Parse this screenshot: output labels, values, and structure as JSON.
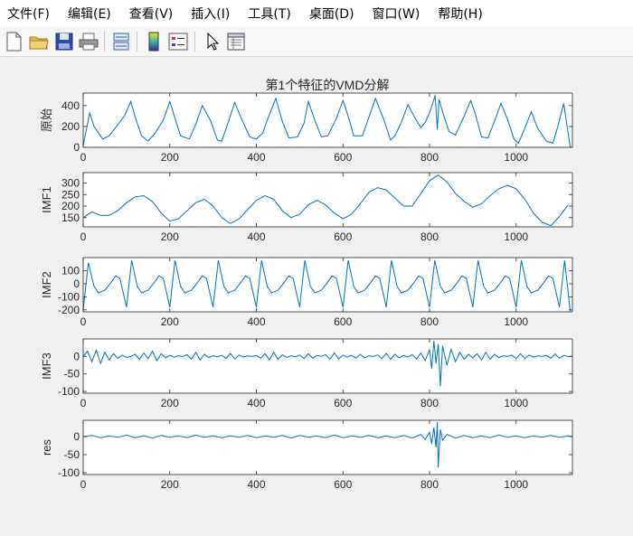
{
  "menubar": {
    "items": [
      "文件(F)",
      "编辑(E)",
      "查看(V)",
      "插入(I)",
      "工具(T)",
      "桌面(D)",
      "窗口(W)",
      "帮助(H)"
    ]
  },
  "toolbar": {
    "icons": [
      "new-file-icon",
      "open-folder-icon",
      "save-icon",
      "print-icon",
      "link-plot-icon",
      "colorbar-icon",
      "legend-icon",
      "pointer-icon",
      "property-inspector-icon"
    ]
  },
  "colors": {
    "line": "#0072BD",
    "axes_bg": "#ffffff",
    "figure_bg": "#f0f0f0"
  },
  "chart_data": {
    "type": "line",
    "title": "第1个特征的VMD分解",
    "xlim": [
      0,
      1130
    ],
    "x_ticks": [
      0,
      200,
      400,
      600,
      800,
      1000
    ],
    "subplots": [
      {
        "ylabel": "原始",
        "ylim": [
          0,
          520
        ],
        "y_ticks": [
          0,
          200,
          400
        ],
        "series": [
          {
            "x": [
              0,
              15,
              25,
              45,
              60,
              75,
              95,
              110,
              120,
              135,
              150,
              165,
              185,
              200,
              215,
              225,
              245,
              260,
              275,
              295,
              310,
              320,
              335,
              350,
              365,
              385,
              400,
              415,
              425,
              445,
              460,
              475,
              495,
              510,
              520,
              535,
              550,
              565,
              585,
              600,
              615,
              625,
              645,
              660,
              675,
              695,
              710,
              720,
              735,
              750,
              765,
              780,
              790,
              800,
              808,
              813,
              818,
              822,
              830,
              845,
              860,
              880,
              895,
              905,
              920,
              935,
              950,
              965,
              980,
              995,
              1005,
              1020,
              1035,
              1050,
              1070,
              1085,
              1095,
              1110,
              1125
            ],
            "y": [
              20,
              330,
              200,
              80,
              110,
              190,
              300,
              440,
              290,
              110,
              60,
              130,
              260,
              440,
              240,
              110,
              80,
              220,
              400,
              250,
              70,
              60,
              240,
              430,
              280,
              100,
              80,
              140,
              260,
              470,
              250,
              90,
              100,
              230,
              440,
              260,
              100,
              110,
              280,
              450,
              260,
              110,
              110,
              290,
              470,
              260,
              70,
              110,
              240,
              410,
              290,
              190,
              240,
              330,
              430,
              500,
              170,
              460,
              340,
              150,
              120,
              300,
              450,
              330,
              100,
              90,
              250,
              420,
              270,
              80,
              40,
              180,
              340,
              180,
              60,
              40,
              180,
              420,
              0
            ]
          }
        ]
      },
      {
        "ylabel": "IMF1",
        "ylim": [
          110,
          345
        ],
        "y_ticks": [
          150,
          200,
          250,
          300
        ],
        "series": [
          {
            "x": [
              0,
              20,
              40,
              60,
              80,
              100,
              120,
              140,
              160,
              180,
              200,
              220,
              240,
              260,
              280,
              300,
              320,
              340,
              360,
              380,
              400,
              420,
              440,
              460,
              480,
              500,
              520,
              540,
              560,
              580,
              600,
              620,
              640,
              660,
              680,
              700,
              720,
              740,
              760,
              780,
              800,
              820,
              840,
              860,
              880,
              900,
              920,
              940,
              960,
              980,
              1000,
              1020,
              1040,
              1060,
              1080,
              1100,
              1120
            ],
            "y": [
              150,
              175,
              160,
              160,
              180,
              215,
              240,
              245,
              220,
              170,
              135,
              145,
              180,
              215,
              230,
              200,
              150,
              125,
              145,
              185,
              225,
              245,
              230,
              180,
              150,
              165,
              205,
              225,
              205,
              170,
              145,
              165,
              210,
              260,
              280,
              270,
              235,
              200,
              200,
              255,
              310,
              335,
              305,
              255,
              220,
              195,
              210,
              245,
              275,
              290,
              275,
              230,
              170,
              130,
              115,
              155,
              205
            ]
          }
        ]
      },
      {
        "ylabel": "IMF2",
        "ylim": [
          -215,
          200
        ],
        "y_ticks": [
          -200,
          -100,
          0,
          100
        ],
        "series": [
          {
            "x": [
              0,
              12,
              25,
              35,
              50,
              62,
              75,
              85,
              100,
              112,
              125,
              135,
              150,
              162,
              175,
              185,
              200,
              212,
              225,
              235,
              250,
              262,
              275,
              285,
              300,
              312,
              325,
              335,
              350,
              362,
              375,
              385,
              400,
              412,
              425,
              435,
              450,
              462,
              475,
              485,
              500,
              512,
              525,
              535,
              550,
              562,
              575,
              585,
              600,
              612,
              625,
              635,
              650,
              662,
              675,
              685,
              700,
              712,
              725,
              735,
              750,
              762,
              775,
              785,
              800,
              812,
              825,
              835,
              850,
              862,
              875,
              885,
              900,
              912,
              925,
              935,
              950,
              962,
              975,
              985,
              1000,
              1012,
              1025,
              1035,
              1050,
              1062,
              1075,
              1085,
              1100,
              1112,
              1125
            ],
            "y": [
              -200,
              160,
              -20,
              -70,
              -50,
              0,
              60,
              40,
              -180,
              180,
              -20,
              -70,
              -50,
              0,
              60,
              40,
              -180,
              180,
              -20,
              -70,
              -50,
              0,
              60,
              40,
              -180,
              180,
              -20,
              -70,
              -50,
              0,
              60,
              40,
              -180,
              180,
              -20,
              -70,
              -50,
              0,
              60,
              40,
              -180,
              180,
              -20,
              -70,
              -50,
              0,
              60,
              40,
              -180,
              180,
              -20,
              -70,
              -50,
              0,
              60,
              40,
              -180,
              180,
              -20,
              -70,
              -50,
              0,
              60,
              40,
              -180,
              180,
              -20,
              -70,
              -50,
              0,
              60,
              40,
              -180,
              180,
              -20,
              -70,
              -50,
              0,
              60,
              40,
              -180,
              180,
              -20,
              -70,
              -50,
              0,
              60,
              40,
              -180,
              180,
              -210
            ]
          }
        ]
      },
      {
        "ylabel": "IMF3",
        "ylim": [
          -105,
          50
        ],
        "y_ticks": [
          -100,
          -50,
          0
        ],
        "series": [
          {
            "x": [
              0,
              10,
              20,
              30,
              40,
              50,
              60,
              70,
              80,
              90,
              100,
              110,
              120,
              130,
              140,
              150,
              160,
              170,
              180,
              190,
              200,
              210,
              220,
              230,
              240,
              250,
              260,
              270,
              280,
              290,
              300,
              310,
              320,
              330,
              340,
              350,
              360,
              370,
              380,
              390,
              400,
              410,
              420,
              430,
              440,
              450,
              460,
              470,
              480,
              490,
              500,
              510,
              520,
              530,
              540,
              550,
              560,
              570,
              580,
              590,
              600,
              610,
              620,
              630,
              640,
              650,
              660,
              670,
              680,
              690,
              700,
              710,
              720,
              730,
              740,
              750,
              760,
              770,
              780,
              790,
              800,
              805,
              810,
              815,
              820,
              825,
              830,
              840,
              850,
              860,
              870,
              880,
              890,
              900,
              910,
              920,
              930,
              940,
              950,
              960,
              970,
              980,
              990,
              1000,
              1010,
              1020,
              1030,
              1040,
              1050,
              1060,
              1070,
              1080,
              1090,
              1100,
              1110,
              1120,
              1130
            ],
            "y": [
              0,
              15,
              -15,
              18,
              -20,
              12,
              -10,
              8,
              -5,
              4,
              -3,
              0,
              6,
              -8,
              10,
              -6,
              15,
              -12,
              8,
              -4,
              3,
              -2,
              2,
              0,
              5,
              -8,
              12,
              -10,
              6,
              -3,
              2,
              -1,
              3,
              -6,
              9,
              -7,
              4,
              -2,
              2,
              0,
              3,
              -5,
              8,
              -10,
              12,
              -8,
              5,
              -3,
              2,
              -1,
              4,
              -6,
              8,
              -5,
              3,
              0,
              5,
              -8,
              10,
              -7,
              4,
              -2,
              3,
              -5,
              6,
              -4,
              2,
              0,
              4,
              -6,
              9,
              -8,
              6,
              -4,
              3,
              -2,
              5,
              -7,
              10,
              -12,
              20,
              -35,
              45,
              -20,
              35,
              -85,
              30,
              -25,
              20,
              -15,
              12,
              -8,
              6,
              -4,
              8,
              -10,
              12,
              -8,
              6,
              -3,
              2,
              0,
              4,
              -6,
              8,
              -6,
              4,
              -2,
              2,
              0,
              3,
              -5,
              7,
              -5,
              3,
              0,
              1
            ]
          }
        ]
      },
      {
        "ylabel": "res",
        "ylim": [
          -105,
          45
        ],
        "y_ticks": [
          -100,
          -50,
          0
        ],
        "series": [
          {
            "x": [
              0,
              20,
              40,
              60,
              80,
              100,
              120,
              140,
              160,
              180,
              200,
              220,
              240,
              260,
              280,
              300,
              320,
              340,
              360,
              380,
              400,
              420,
              440,
              460,
              480,
              500,
              520,
              540,
              560,
              580,
              600,
              620,
              640,
              660,
              680,
              700,
              720,
              740,
              760,
              780,
              790,
              800,
              805,
              810,
              815,
              818,
              820,
              825,
              830,
              840,
              860,
              880,
              900,
              920,
              940,
              960,
              980,
              1000,
              1020,
              1040,
              1060,
              1080,
              1100,
              1120,
              1130
            ],
            "y": [
              0,
              3,
              -3,
              2,
              -2,
              4,
              -3,
              2,
              -4,
              3,
              -2,
              2,
              -3,
              4,
              -2,
              2,
              -3,
              2,
              -2,
              3,
              -3,
              2,
              -2,
              3,
              -4,
              3,
              -2,
              2,
              -3,
              4,
              -3,
              2,
              -2,
              3,
              -3,
              2,
              -3,
              3,
              -4,
              6,
              -8,
              12,
              -20,
              25,
              -30,
              40,
              -85,
              20,
              -10,
              6,
              -4,
              3,
              -3,
              2,
              -3,
              4,
              -2,
              2,
              -3,
              2,
              -2,
              3,
              -2,
              2,
              0
            ]
          }
        ]
      }
    ]
  }
}
